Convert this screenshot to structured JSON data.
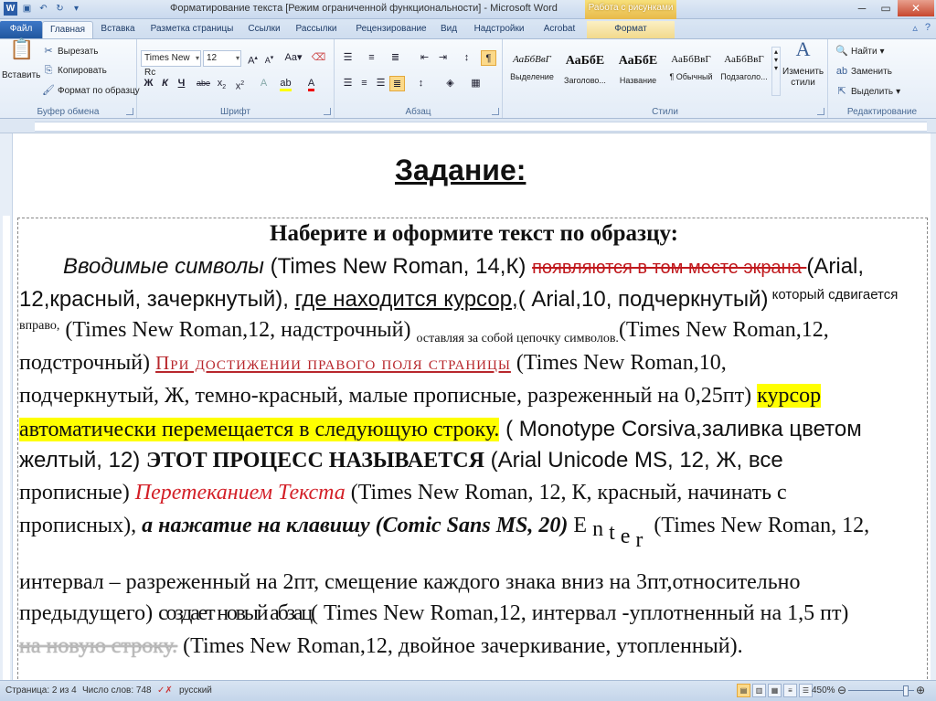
{
  "titlebar": {
    "title": "Форматирование текста [Режим ограниченной функциональности] - Microsoft Word",
    "context_tab_title": "Работа с рисунками"
  },
  "tabs": [
    {
      "label": "Файл"
    },
    {
      "label": "Главная"
    },
    {
      "label": "Вставка"
    },
    {
      "label": "Разметка страницы"
    },
    {
      "label": "Ссылки"
    },
    {
      "label": "Рассылки"
    },
    {
      "label": "Рецензирование"
    },
    {
      "label": "Вид"
    },
    {
      "label": "Надстройки"
    },
    {
      "label": "Acrobat"
    },
    {
      "label": "Формат"
    }
  ],
  "ribbon": {
    "clipboard": {
      "paste": "Вставить",
      "cut": "Вырезать",
      "copy": "Копировать",
      "format_painter": "Формат по образцу",
      "label": "Буфер обмена"
    },
    "font": {
      "font_name": "Times New Rc",
      "font_size": "12",
      "label": "Шрифт"
    },
    "paragraph": {
      "label": "Абзац"
    },
    "styles": {
      "label": "Стили",
      "items": [
        {
          "sample": "АаБбВвГ",
          "name": "Выделение"
        },
        {
          "sample": "АаБбЕ",
          "name": "Заголово..."
        },
        {
          "sample": "АаБбЕ",
          "name": "Название"
        },
        {
          "sample": "АаБбВвГ",
          "name": "¶ Обычный"
        },
        {
          "sample": "АаБбВвГ",
          "name": "Подзаголо..."
        }
      ],
      "change_styles_1": "Изменить",
      "change_styles_2": "стили"
    },
    "editing": {
      "find": "Найти",
      "replace": "Заменить",
      "select": "Выделить",
      "label": "Редактирование"
    }
  },
  "document": {
    "heading": "Задание:",
    "instruction_title": "Наберите и оформите текст по образцу:",
    "l1_a": "Вводимые символы",
    "l1_b": " (Times New Roman, 14,К) ",
    "l1_c": "появляются в том месте экрана ",
    "l1_d": " (Arial,",
    "l2_a": "12,красный, зачеркнутый), ",
    "l2_b": "где находится курсор,",
    "l2_c": "( Arial,10, подчеркнутый)",
    "l2_d": " который сдвигается",
    "l3_a": "вправо,",
    "l3_b": " (Times New Roman,12, надстрочный) ",
    "l3_c": "оставляя за собой цепочку символов.",
    "l3_d": "(Times New Roman,12,",
    "l4_a": "подстрочный) ",
    "l4_b": "При достижении правого поля страницы",
    "l4_c": " (Times New Roman,10,",
    "l5_a": "подчеркнутый, Ж, темно-красный, малые прописные, разреженный на 0,25пт) ",
    "l5_b": "курсор",
    "l6_a": "автоматически перемещается в следующую строку.",
    "l6_b": " ( Monotype Corsiva,заливка цветом",
    "l7_a": "желтый, 12)  ",
    "l7_b": "ЭТОТ ПРОЦЕСС НАЗЫВАЕТСЯ",
    "l7_c": " (Arial Unicode MS, 12, Ж, все",
    "l8_a": "прописные) ",
    "l8_b": "Перетеканием Текста",
    "l8_c": " (Times New Roman, 12, К, красный, начинать с",
    "l9_a": "прописных), ",
    "l9_b": "а нажатие на клавишу (Comic Sans MS, 20) ",
    "l9_e": "E",
    "l9_n": "n",
    "l9_t": "t",
    "l9_e2": "e",
    "l9_r": "r",
    "l9_c": " (Times New Roman, 12,",
    "l10": "интервал – разреженный на 2пт, смещение каждого знака вниз на 3пт,относительно",
    "l11_a": "предыдущего) ",
    "l11_b": "создает новый абзац",
    "l11_c": "( Times New Roman,12, интервал -уплотненный на 1,5 пт)",
    "l12_a": "на новую строку.",
    "l12_b": "  (Times New Roman,12, двойное зачеркивание, утопленный)."
  },
  "statusbar": {
    "page": "Страница: 2 из 4",
    "words": "Число слов: 748",
    "language": "русский",
    "zoom": "450%"
  }
}
